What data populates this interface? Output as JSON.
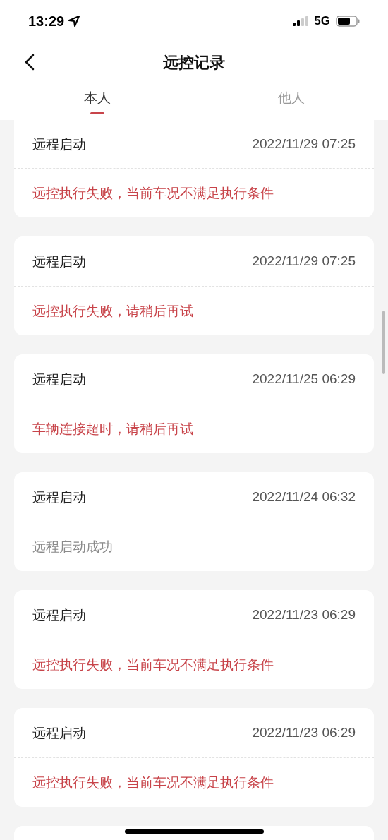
{
  "status_bar": {
    "time": "13:29",
    "network": "5G"
  },
  "header": {
    "title": "远控记录"
  },
  "tabs": [
    {
      "label": "本人",
      "selected": true
    },
    {
      "label": "他人",
      "selected": false
    }
  ],
  "records": [
    {
      "action": "远程启动",
      "time": "2022/11/29 07:25",
      "message": "远控执行失败，当前车况不满足执行条件",
      "kind": "error"
    },
    {
      "action": "远程启动",
      "time": "2022/11/29 07:25",
      "message": "远控执行失败，请稍后再试",
      "kind": "error"
    },
    {
      "action": "远程启动",
      "time": "2022/11/25 06:29",
      "message": "车辆连接超时，请稍后再试",
      "kind": "error"
    },
    {
      "action": "远程启动",
      "time": "2022/11/24 06:32",
      "message": "远程启动成功",
      "kind": "success"
    },
    {
      "action": "远程启动",
      "time": "2022/11/23 06:29",
      "message": "远控执行失败，当前车况不满足执行条件",
      "kind": "error"
    },
    {
      "action": "远程启动",
      "time": "2022/11/23 06:29",
      "message": "远控执行失败，当前车况不满足执行条件",
      "kind": "error"
    }
  ]
}
